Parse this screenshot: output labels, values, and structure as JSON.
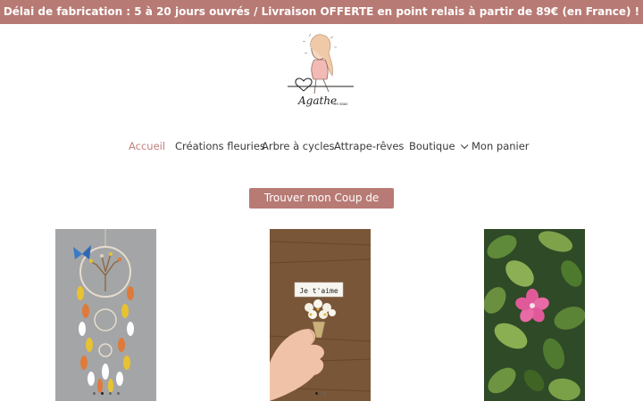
{
  "announcement": "Délai de fabrication : 5 à 20 jours ouvrés / Livraison OFFERTE en point relais à partir de 89€ (en France) !",
  "logo": {
    "text": "Agathe",
    "subtext": "en sous"
  },
  "nav": {
    "items": [
      {
        "label": "Accueil",
        "active": true
      },
      {
        "label": "Créations fleuries"
      },
      {
        "label": "Arbre à cycles"
      },
      {
        "label": "Attrape-rêves"
      },
      {
        "label": "Boutique",
        "has_dropdown": true
      },
      {
        "label": "Mon panier"
      }
    ]
  },
  "cta": {
    "label": "Trouver mon Coup de cœur !"
  },
  "products": [
    {
      "name": "dreamcatcher-image"
    },
    {
      "name": "je-taime-bouquet-image",
      "card_text": "Je t'aime"
    },
    {
      "name": "pink-flower-plant-image"
    }
  ],
  "colors": {
    "accent": "#b87a74",
    "active_nav": "#c0817b"
  }
}
